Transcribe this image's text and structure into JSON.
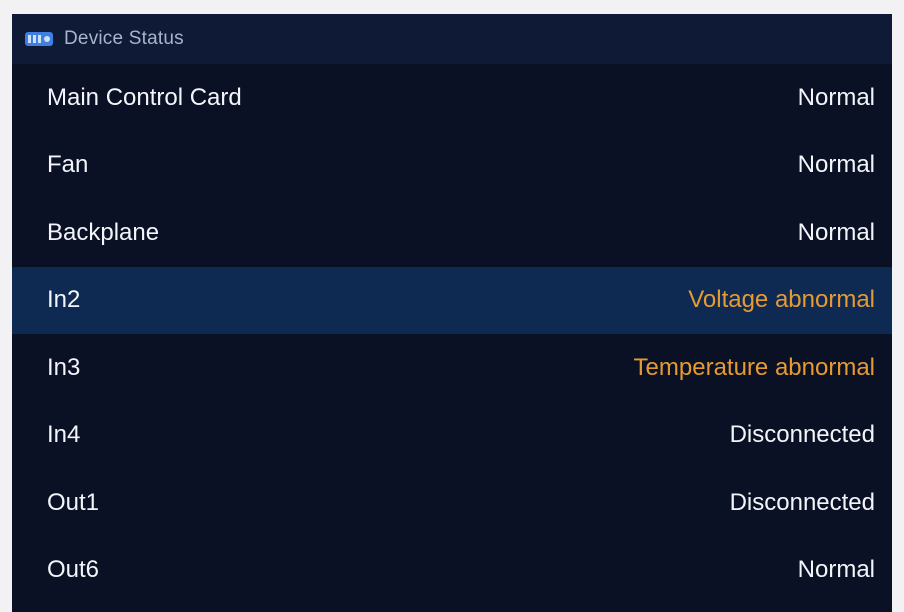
{
  "window": {
    "title": "Device Status",
    "icon": "device-icon"
  },
  "colors": {
    "panel_bg": "#0a1124",
    "titlebar_bg": "#0e1a36",
    "selected_row_bg": "#0f2a52",
    "text": "#f3f5fa",
    "warning": "#e69a32"
  },
  "rows": [
    {
      "label": "Main Control Card",
      "status": "Normal",
      "warning": false,
      "selected": false
    },
    {
      "label": "Fan",
      "status": "Normal",
      "warning": false,
      "selected": false
    },
    {
      "label": "Backplane",
      "status": "Normal",
      "warning": false,
      "selected": false
    },
    {
      "label": "In2",
      "status": "Voltage abnormal",
      "warning": true,
      "selected": true
    },
    {
      "label": "In3",
      "status": "Temperature abnormal",
      "warning": true,
      "selected": false
    },
    {
      "label": "In4",
      "status": "Disconnected",
      "warning": false,
      "selected": false
    },
    {
      "label": "Out1",
      "status": "Disconnected",
      "warning": false,
      "selected": false
    },
    {
      "label": "Out6",
      "status": "Normal",
      "warning": false,
      "selected": false
    }
  ]
}
